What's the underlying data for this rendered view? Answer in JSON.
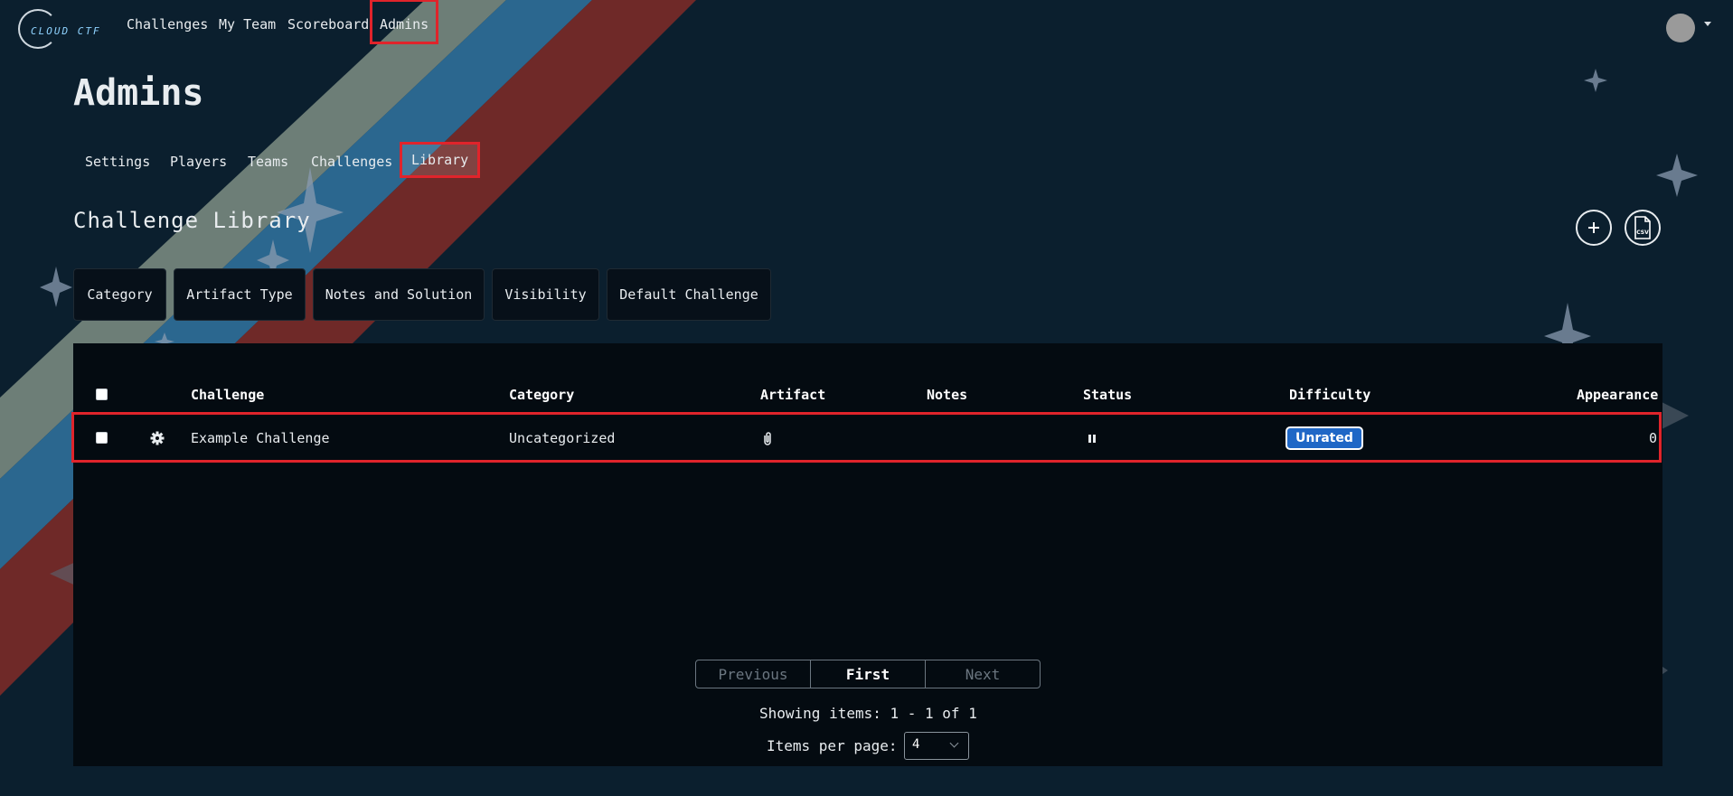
{
  "brand": {
    "logo_text": "CLOUD CTF"
  },
  "nav": {
    "challenges": "Challenges",
    "my_team": "My Team",
    "scoreboard": "Scoreboard",
    "admins": "Admins"
  },
  "page": {
    "title": "Admins"
  },
  "subnav": {
    "settings": "Settings",
    "players": "Players",
    "teams": "Teams",
    "challenges": "Challenges",
    "library": "Library"
  },
  "library": {
    "title": "Challenge Library",
    "add_icon": "plus-icon",
    "csv_icon": "csv-file-icon",
    "csv_label": "CSV"
  },
  "filters": {
    "category": "Category",
    "artifact_type": "Artifact Type",
    "notes_solution": "Notes and Solution",
    "visibility": "Visibility",
    "default_challenge": "Default Challenge"
  },
  "table": {
    "headers": {
      "challenge": "Challenge",
      "category": "Category",
      "artifact": "Artifact",
      "notes": "Notes",
      "status": "Status",
      "difficulty": "Difficulty",
      "appearance": "Appearance"
    },
    "rows": [
      {
        "challenge": "Example Challenge",
        "category": "Uncategorized",
        "artifact_icon": "paperclip-icon",
        "notes": "",
        "status_icon": "pause-icon",
        "difficulty": "Unrated",
        "appearance": "0"
      }
    ]
  },
  "pagination": {
    "previous": "Previous",
    "first": "First",
    "next": "Next",
    "showing": "Showing items: 1 - 1 of 1",
    "items_per_page_label": "Items per page:",
    "items_per_page_value": "4"
  },
  "colors": {
    "background": "#0b1f2e",
    "highlight": "#e0242b",
    "badge": "#1f67c6",
    "stripe_gray": "#8a9a8a",
    "stripe_blue": "#2f6f9a",
    "stripe_red": "#7a2a28"
  }
}
